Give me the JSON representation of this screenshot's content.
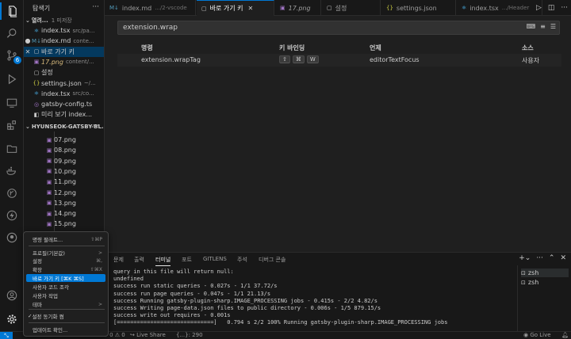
{
  "sidebar": {
    "title": "탐색기",
    "open_editors_label": "열려...",
    "unsaved_note": "1 미저장",
    "open_editors": [
      {
        "close": "",
        "icon": "tsx",
        "name": "index.tsx",
        "desc": "src/pa..."
      },
      {
        "close": "●",
        "icon": "md",
        "name": "index.md",
        "desc": "conte..."
      },
      {
        "close": "✕",
        "icon": "file",
        "name": "바로 가기 키",
        "desc": ""
      },
      {
        "close": "",
        "icon": "png",
        "name": "17.png",
        "desc": "content/..."
      },
      {
        "close": "",
        "icon": "file",
        "name": "설정",
        "desc": ""
      },
      {
        "close": "",
        "icon": "json",
        "name": "settings.json",
        "desc": "~/..."
      },
      {
        "close": "",
        "icon": "tsx",
        "name": "index.tsx",
        "desc": "src/co..."
      },
      {
        "close": "",
        "icon": "gatsby",
        "name": "gatsby-config.ts",
        "desc": ""
      },
      {
        "close": "",
        "icon": "preview",
        "name": "미리 보기 index...",
        "desc": ""
      }
    ],
    "project_label": "HYUNSEOK-GATSBY-BL...",
    "files": [
      "07.png",
      "08.png",
      "09.png",
      "10.png",
      "11.png",
      "12.png",
      "13.png",
      "14.png",
      "15.png"
    ]
  },
  "tabs": [
    {
      "name": "index.md",
      "desc": ".../2-vscode",
      "active": false,
      "italic": false
    },
    {
      "name": "바로 가기 키",
      "desc": "",
      "active": true,
      "italic": false
    },
    {
      "name": "17.png",
      "desc": "",
      "active": false,
      "italic": true
    },
    {
      "name": "설정",
      "desc": "",
      "active": false,
      "italic": false
    },
    {
      "name": "settings.json",
      "desc": "",
      "active": false,
      "italic": false
    },
    {
      "name": "index.tsx",
      "desc": ".../Header",
      "active": false,
      "italic": false
    }
  ],
  "keybindings": {
    "search_value": "extension.wrap",
    "columns": {
      "command": "명령",
      "keybinding": "키 바인딩",
      "when": "언제",
      "source": "소스"
    },
    "row": {
      "command": "extension.wrapTag",
      "keys": [
        "⇧",
        "⌘",
        "W"
      ],
      "when": "editorTextFocus",
      "source": "사용자"
    }
  },
  "panel": {
    "tabs": [
      "문제",
      "출력",
      "터미널",
      "포트",
      "GITLENS",
      "주석",
      "디버그 콘솔"
    ],
    "active_tab": "터미널",
    "terminal_lines": [
      "query in this file will return null:",
      "undefined",
      "success run static queries - 0.027s - 1/1 37.72/s",
      "success run page queries - 0.047s - 1/1 21.13/s",
      "success Running gatsby-plugin-sharp.IMAGE_PROCESSING jobs - 0.415s - 2/2 4.82/s",
      "success Writing page-data.json files to public directory - 0.006s - 1/5 879.15/s",
      "success write out requires - 0.001s",
      "[=============================]   0.794 s 2/2 100% Running gatsby-plugin-sharp.IMAGE_PROCESSING jobs"
    ],
    "terminals": [
      "zsh",
      "zsh"
    ]
  },
  "menu": {
    "items": [
      {
        "label": "명령 팔레트...",
        "key": "⇧⌘P"
      },
      {
        "label": "프로필(기본값)",
        "key": ">"
      },
      {
        "label": "설정",
        "key": "⌘,"
      },
      {
        "label": "확장",
        "key": "⇧⌘X"
      },
      {
        "label": "바로 가기 키 [⌘K ⌘S]",
        "key": ""
      },
      {
        "label": "사용자 코드 조각",
        "key": ""
      },
      {
        "label": "사용자 작업",
        "key": ""
      },
      {
        "label": "테마",
        "key": ">"
      },
      {
        "label": "설정 동기화 켬",
        "key": ""
      },
      {
        "label": "업데이트 확인...",
        "key": ""
      }
    ]
  },
  "status": {
    "errors": "0",
    "warnings": "0",
    "live_share": "Live Share",
    "selection": "{...}: 290",
    "go_live": "Go Live"
  },
  "colors": {
    "accent": "#0078d4",
    "background": "#1f1f1f",
    "sidebar": "#181818"
  }
}
